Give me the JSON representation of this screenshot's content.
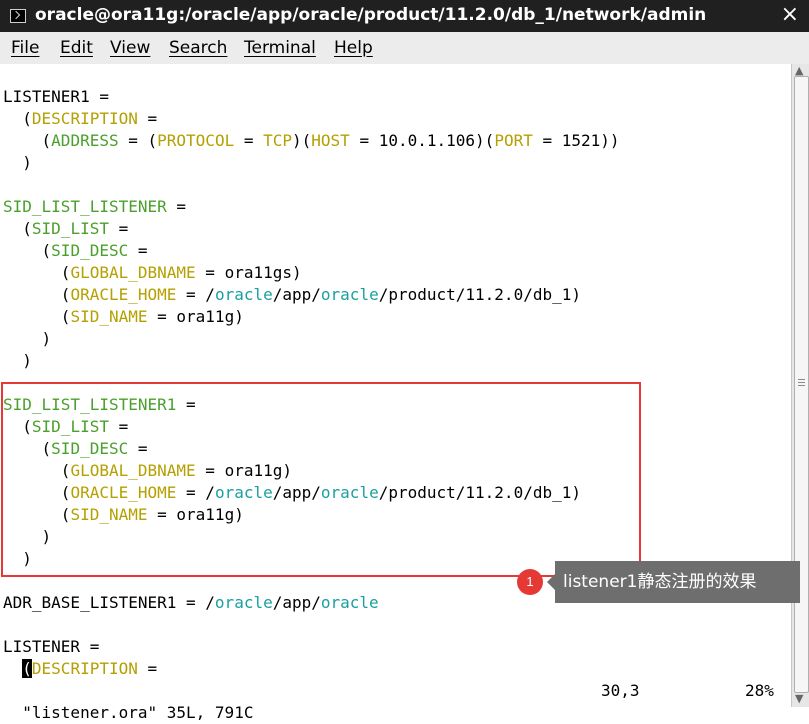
{
  "window": {
    "title": "oracle@ora11g:/oracle/app/oracle/product/11.2.0/db_1/network/admin",
    "close_glyph": "×"
  },
  "menu": [
    "File",
    "Edit",
    "View",
    "Search",
    "Terminal",
    "Help"
  ],
  "lines": [
    {
      "segs": [
        {
          "t": "",
          "c": "n"
        }
      ]
    },
    {
      "segs": [
        {
          "t": "LISTENER1 =",
          "c": "n"
        }
      ]
    },
    {
      "segs": [
        {
          "t": "  (",
          "c": "n"
        },
        {
          "t": "DESCRIPTION",
          "c": "k"
        },
        {
          "t": " =",
          "c": "n"
        }
      ]
    },
    {
      "segs": [
        {
          "t": "    (",
          "c": "n"
        },
        {
          "t": "ADDRESS",
          "c": "g"
        },
        {
          "t": " = (",
          "c": "n"
        },
        {
          "t": "PROTOCOL",
          "c": "k"
        },
        {
          "t": " = ",
          "c": "n"
        },
        {
          "t": "TCP",
          "c": "k"
        },
        {
          "t": ")(",
          "c": "n"
        },
        {
          "t": "HOST",
          "c": "k"
        },
        {
          "t": " = 10.0.1.106)(",
          "c": "n"
        },
        {
          "t": "PORT",
          "c": "k"
        },
        {
          "t": " = 1521))",
          "c": "n"
        }
      ]
    },
    {
      "segs": [
        {
          "t": "  )",
          "c": "n"
        }
      ]
    },
    {
      "segs": [
        {
          "t": "",
          "c": "n"
        }
      ]
    },
    {
      "segs": [
        {
          "t": "SID_LIST_LISTENER",
          "c": "g"
        },
        {
          "t": " =",
          "c": "n"
        }
      ]
    },
    {
      "segs": [
        {
          "t": "  (",
          "c": "n"
        },
        {
          "t": "SID_LIST",
          "c": "g"
        },
        {
          "t": " =",
          "c": "n"
        }
      ]
    },
    {
      "segs": [
        {
          "t": "    (",
          "c": "n"
        },
        {
          "t": "SID_DESC",
          "c": "g"
        },
        {
          "t": " =",
          "c": "n"
        }
      ]
    },
    {
      "segs": [
        {
          "t": "      (",
          "c": "n"
        },
        {
          "t": "GLOBAL_DBNAME",
          "c": "k"
        },
        {
          "t": " = ora11gs)",
          "c": "n"
        }
      ]
    },
    {
      "segs": [
        {
          "t": "      (",
          "c": "n"
        },
        {
          "t": "ORACLE_HOME",
          "c": "k"
        },
        {
          "t": " = /",
          "c": "n"
        },
        {
          "t": "oracle",
          "c": "t"
        },
        {
          "t": "/app/",
          "c": "n"
        },
        {
          "t": "oracle",
          "c": "t"
        },
        {
          "t": "/product/11.2.0/db_1)",
          "c": "n"
        }
      ]
    },
    {
      "segs": [
        {
          "t": "      (",
          "c": "n"
        },
        {
          "t": "SID_NAME",
          "c": "k"
        },
        {
          "t": " = ora11g)",
          "c": "n"
        }
      ]
    },
    {
      "segs": [
        {
          "t": "    )",
          "c": "n"
        }
      ]
    },
    {
      "segs": [
        {
          "t": "  )",
          "c": "n"
        }
      ]
    },
    {
      "segs": [
        {
          "t": "",
          "c": "n"
        }
      ]
    },
    {
      "segs": [
        {
          "t": "SID_LIST_LISTENER1",
          "c": "g"
        },
        {
          "t": " =",
          "c": "n"
        }
      ]
    },
    {
      "segs": [
        {
          "t": "  (",
          "c": "n"
        },
        {
          "t": "SID_LIST",
          "c": "g"
        },
        {
          "t": " =",
          "c": "n"
        }
      ]
    },
    {
      "segs": [
        {
          "t": "    (",
          "c": "n"
        },
        {
          "t": "SID_DESC",
          "c": "g"
        },
        {
          "t": " =",
          "c": "n"
        }
      ]
    },
    {
      "segs": [
        {
          "t": "      (",
          "c": "n"
        },
        {
          "t": "GLOBAL_DBNAME",
          "c": "k"
        },
        {
          "t": " = ora11g)",
          "c": "n"
        }
      ]
    },
    {
      "segs": [
        {
          "t": "      (",
          "c": "n"
        },
        {
          "t": "ORACLE_HOME",
          "c": "k"
        },
        {
          "t": " = /",
          "c": "n"
        },
        {
          "t": "oracle",
          "c": "t"
        },
        {
          "t": "/app/",
          "c": "n"
        },
        {
          "t": "oracle",
          "c": "t"
        },
        {
          "t": "/product/11.2.0/db_1)",
          "c": "n"
        }
      ]
    },
    {
      "segs": [
        {
          "t": "      (",
          "c": "n"
        },
        {
          "t": "SID_NAME",
          "c": "k"
        },
        {
          "t": " = ora11g)",
          "c": "n"
        }
      ]
    },
    {
      "segs": [
        {
          "t": "    )",
          "c": "n"
        }
      ]
    },
    {
      "segs": [
        {
          "t": "  )",
          "c": "n"
        }
      ]
    },
    {
      "segs": [
        {
          "t": "",
          "c": "n"
        }
      ]
    },
    {
      "segs": [
        {
          "t": "ADR_BASE_LISTENER1 = /",
          "c": "n"
        },
        {
          "t": "oracle",
          "c": "t"
        },
        {
          "t": "/app/",
          "c": "n"
        },
        {
          "t": "oracle",
          "c": "t"
        }
      ]
    },
    {
      "segs": [
        {
          "t": "",
          "c": "n"
        }
      ]
    },
    {
      "segs": [
        {
          "t": "LISTENER =",
          "c": "n"
        }
      ]
    },
    {
      "segs": [
        {
          "t": "  ",
          "c": "n"
        },
        {
          "t": "(",
          "c": "cursor"
        },
        {
          "t": "DESCRIPTION",
          "c": "k"
        },
        {
          "t": " =",
          "c": "n"
        }
      ]
    }
  ],
  "status": {
    "file": "\"listener.ora\" 35L, 791C",
    "position": "30,3",
    "percent": "28%"
  },
  "annotation": {
    "number": "1",
    "text": "listener1静态注册的效果"
  },
  "colors": {
    "keyword": "#b5a000",
    "green": "#4aa02c",
    "teal": "#1aa0a0",
    "title_bg": "#202020",
    "menu_bg": "#ececec",
    "highlight": "#e53935"
  }
}
